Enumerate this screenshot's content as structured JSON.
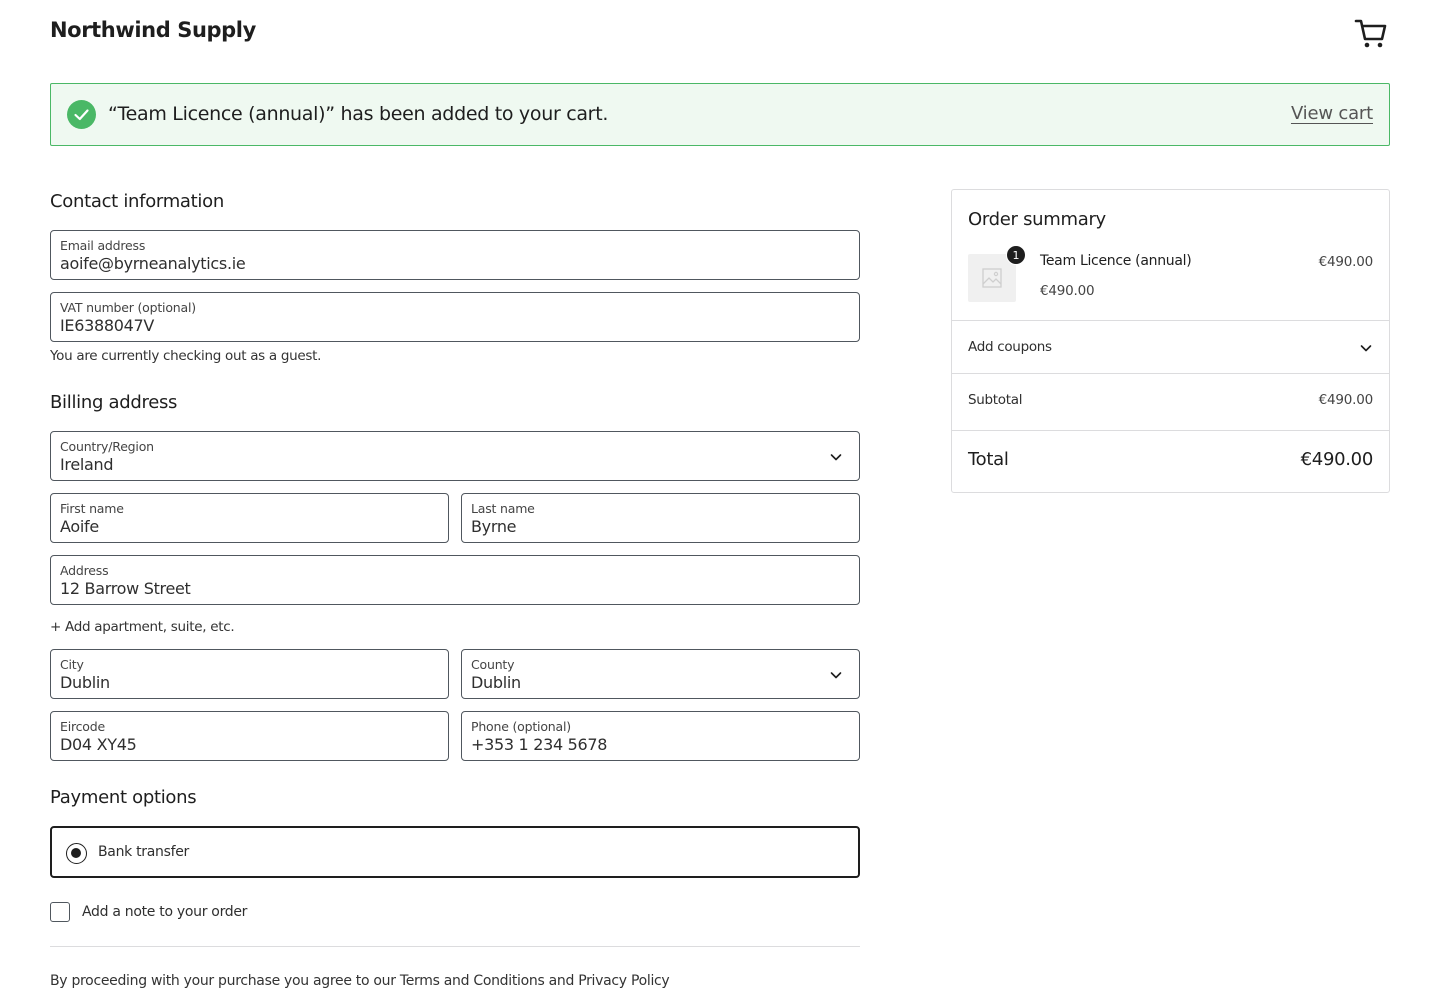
{
  "header": {
    "brand": "Northwind Supply",
    "cart_icon": "cart-icon"
  },
  "notice": {
    "icon": "check-circle-icon",
    "message": "“Team Licence (annual)” has been added to your cart.",
    "link": "View cart",
    "accent_color": "#4ab866"
  },
  "contact": {
    "title": "Contact information",
    "email": {
      "label": "Email address",
      "value": "aoife@byrneanalytics.ie"
    },
    "vat": {
      "label": "VAT number (optional)",
      "value": "IE6388047V"
    },
    "guest_note": "You are currently checking out as a guest."
  },
  "billing": {
    "title": "Billing address",
    "country": {
      "label": "Country/Region",
      "value": "Ireland"
    },
    "first_name": {
      "label": "First name",
      "value": "Aoife"
    },
    "last_name": {
      "label": "Last name",
      "value": "Byrne"
    },
    "address": {
      "label": "Address",
      "value": "12 Barrow Street"
    },
    "add_apartment": "+ Add apartment, suite, etc.",
    "city": {
      "label": "City",
      "value": "Dublin"
    },
    "county": {
      "label": "County",
      "value": "Dublin"
    },
    "eircode": {
      "label": "Eircode",
      "value": "D04 XY45"
    },
    "phone": {
      "label": "Phone (optional)",
      "value": "+353 1 234 5678"
    }
  },
  "payment": {
    "title": "Payment options",
    "options": [
      {
        "label": "Bank transfer",
        "selected": true
      }
    ]
  },
  "note": {
    "label": "Add a note to your order",
    "checked": false
  },
  "legal": {
    "prefix": "By proceeding with your purchase you agree to our ",
    "terms": "Terms and Conditions",
    "and": " and ",
    "privacy": "Privacy Policy"
  },
  "summary": {
    "title": "Order summary",
    "item": {
      "name": "Team Licence (annual)",
      "quantity": "1",
      "line_price": "€490.00",
      "unit_price": "€490.00"
    },
    "coupons_label": "Add coupons",
    "subtotal_label": "Subtotal",
    "subtotal_value": "€490.00",
    "total_label": "Total",
    "total_value": "€490.00"
  }
}
